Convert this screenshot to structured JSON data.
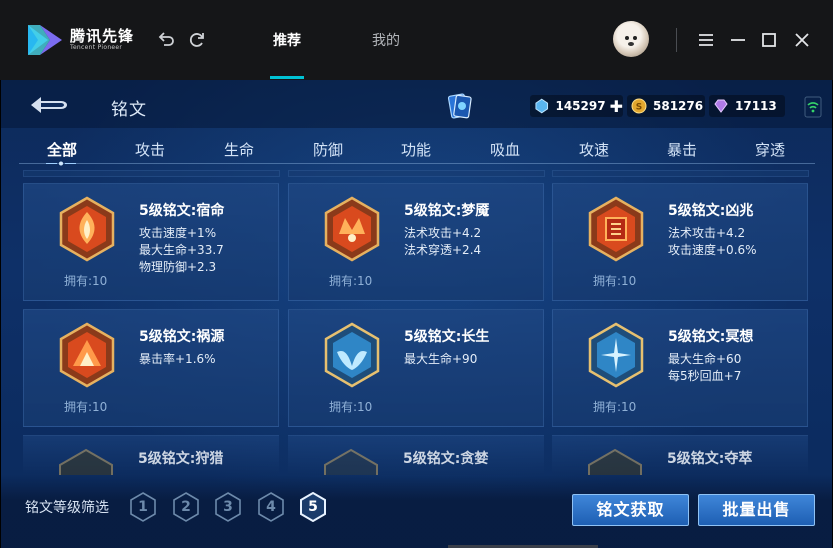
{
  "launcher": {
    "logo_cn": "腾讯先锋",
    "logo_en": "Tencent Pioneer",
    "tabs": [
      {
        "label": "推荐",
        "active": true
      },
      {
        "label": "我的",
        "active": false
      }
    ],
    "accent_color": "#00c2d4"
  },
  "game": {
    "title": "铭文",
    "resources": [
      {
        "icon": "blue-crystal-icon",
        "value": "145297",
        "has_plus": true
      },
      {
        "icon": "gold-coin-icon",
        "value": "581276",
        "has_plus": false
      },
      {
        "icon": "purple-gem-icon",
        "value": "17113",
        "has_plus": false
      }
    ],
    "categories": [
      "全部",
      "攻击",
      "生命",
      "防御",
      "功能",
      "吸血",
      "攻速",
      "暴击",
      "穿透"
    ],
    "active_category": "全部",
    "runes": [
      {
        "name": "5级铭文:宿命",
        "stats": [
          "攻击速度+1%",
          "最大生命+33.7",
          "物理防御+2.3"
        ],
        "owned": "拥有:10",
        "color": "red"
      },
      {
        "name": "5级铭文:梦魇",
        "stats": [
          "法术攻击+4.2",
          "法术穿透+2.4"
        ],
        "owned": "拥有:10",
        "color": "red"
      },
      {
        "name": "5级铭文:凶兆",
        "stats": [
          "法术攻击+4.2",
          "攻击速度+0.6%"
        ],
        "owned": "拥有:10",
        "color": "red"
      },
      {
        "name": "5级铭文:祸源",
        "stats": [
          "暴击率+1.6%"
        ],
        "owned": "拥有:10",
        "color": "red"
      },
      {
        "name": "5级铭文:长生",
        "stats": [
          "最大生命+90"
        ],
        "owned": "拥有:10",
        "color": "blue"
      },
      {
        "name": "5级铭文:冥想",
        "stats": [
          "最大生命+60",
          "每5秒回血+7"
        ],
        "owned": "拥有:10",
        "color": "blue"
      }
    ],
    "partial_runes": [
      "5级铭文:狩猎",
      "5级铭文:贪婪",
      "5级铭文:夺萃"
    ],
    "filter_label": "铭文等级筛选",
    "levels": [
      "1",
      "2",
      "3",
      "4",
      "5"
    ],
    "selected_level": "5",
    "buttons": {
      "get": "铭文获取",
      "sell": "批量出售"
    }
  }
}
